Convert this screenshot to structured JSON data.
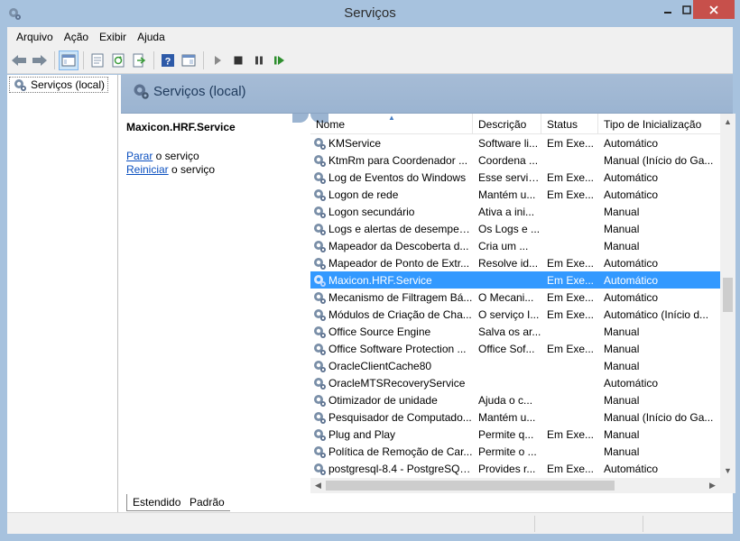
{
  "window": {
    "title": "Serviços"
  },
  "menu": [
    {
      "label": "Arquivo"
    },
    {
      "label": "Ação"
    },
    {
      "label": "Exibir"
    },
    {
      "label": "Ajuda"
    }
  ],
  "tree": {
    "root_label": "Serviços (local)"
  },
  "banner": {
    "title": "Serviços (local)"
  },
  "description": {
    "service_name": "Maxicon.HRF.Service",
    "link_stop": "Parar",
    "link_stop_suffix": " o serviço",
    "link_restart": "Reiniciar",
    "link_restart_suffix": " o serviço"
  },
  "columns": [
    {
      "label": "Nome"
    },
    {
      "label": "Descrição"
    },
    {
      "label": "Status"
    },
    {
      "label": "Tipo de Inicialização"
    }
  ],
  "rows": [
    {
      "name": "KMService",
      "desc": "Software li...",
      "status": "Em Exe...",
      "startup": "Automático"
    },
    {
      "name": "KtmRm para Coordenador ...",
      "desc": "Coordena ...",
      "status": "",
      "startup": "Manual (Início do Ga..."
    },
    {
      "name": "Log de Eventos do Windows",
      "desc": "Esse serviç...",
      "status": "Em Exe...",
      "startup": "Automático"
    },
    {
      "name": "Logon de rede",
      "desc": "Mantém u...",
      "status": "Em Exe...",
      "startup": "Automático"
    },
    {
      "name": "Logon secundário",
      "desc": "Ativa a ini...",
      "status": "",
      "startup": "Manual"
    },
    {
      "name": "Logs e alertas de desempen...",
      "desc": "Os Logs e ...",
      "status": "",
      "startup": "Manual"
    },
    {
      "name": "Mapeador da Descoberta d...",
      "desc": "Cria um ...",
      "status": "",
      "startup": "Manual"
    },
    {
      "name": "Mapeador de Ponto de Extr...",
      "desc": "Resolve id...",
      "status": "Em Exe...",
      "startup": "Automático"
    },
    {
      "name": "Maxicon.HRF.Service",
      "desc": "",
      "status": "Em Exe...",
      "startup": "Automático",
      "selected": true
    },
    {
      "name": "Mecanismo de Filtragem Bá...",
      "desc": "O Mecani...",
      "status": "Em Exe...",
      "startup": "Automático"
    },
    {
      "name": "Módulos de Criação de Cha...",
      "desc": "O serviço I...",
      "status": "Em Exe...",
      "startup": "Automático (Início d..."
    },
    {
      "name": "Office  Source Engine",
      "desc": "Salva os ar...",
      "status": "",
      "startup": "Manual"
    },
    {
      "name": "Office Software Protection ...",
      "desc": "Office Sof...",
      "status": "Em Exe...",
      "startup": "Manual"
    },
    {
      "name": "OracleClientCache80",
      "desc": "",
      "status": "",
      "startup": "Manual"
    },
    {
      "name": "OracleMTSRecoveryService",
      "desc": "",
      "status": "",
      "startup": "Automático"
    },
    {
      "name": "Otimizador de unidade",
      "desc": "Ajuda o c...",
      "status": "",
      "startup": "Manual"
    },
    {
      "name": "Pesquisador de Computado...",
      "desc": "Mantém u...",
      "status": "",
      "startup": "Manual (Início do Ga..."
    },
    {
      "name": "Plug and Play",
      "desc": "Permite q...",
      "status": "Em Exe...",
      "startup": "Manual"
    },
    {
      "name": "Política de Remoção de Car...",
      "desc": "Permite o ...",
      "status": "",
      "startup": "Manual"
    },
    {
      "name": "postgresql-8.4 - PostgreSQL...",
      "desc": "Provides r...",
      "status": "Em Exe...",
      "startup": "Automático"
    }
  ],
  "tabs": [
    {
      "label": "Estendido"
    },
    {
      "label": "Padrão"
    }
  ],
  "icons": {
    "app": "services-gear-icon",
    "back": "back-arrow-icon",
    "forward": "forward-arrow-icon",
    "start": "play-icon",
    "stop": "stop-icon",
    "pause": "pause-icon",
    "restart": "restart-icon"
  }
}
